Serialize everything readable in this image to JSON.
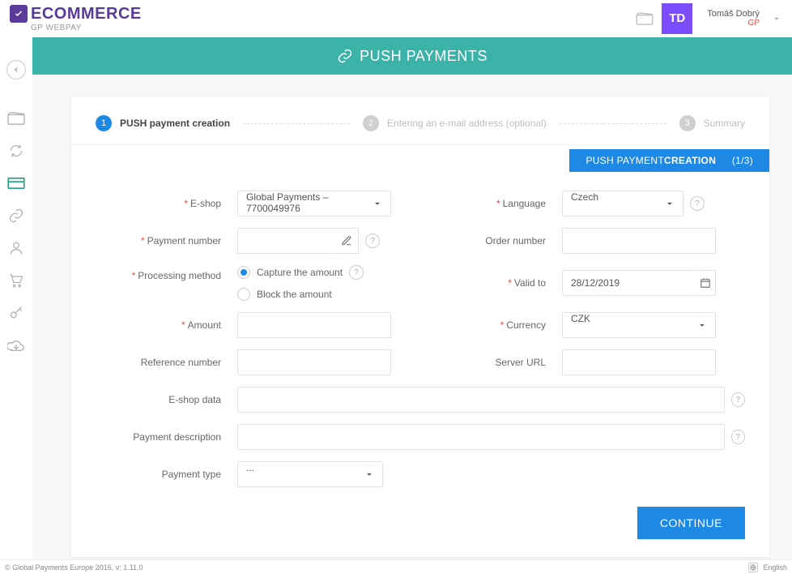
{
  "header": {
    "brand": "ECOMMERCE",
    "brand_sub": "GP WEBPAY",
    "avatar": "TD",
    "user_name": "Tomáš Dobrý",
    "user_co": "GP"
  },
  "banner": {
    "title": "PUSH PAYMENTS"
  },
  "stepper": {
    "s1": {
      "num": "1",
      "label": "PUSH payment creation"
    },
    "s2": {
      "num": "2",
      "label": "Entering an e-mail address (optional)"
    },
    "s3": {
      "num": "3",
      "label": "Summary"
    }
  },
  "progress": {
    "pre": "PUSH PAYMENT",
    "bold": "CREATION",
    "frac": "(1/3)"
  },
  "labels": {
    "eshop": "E-shop",
    "language": "Language",
    "payment_number": "Payment number",
    "order_number": "Order number",
    "processing_method": "Processing method",
    "valid_to": "Valid to",
    "amount": "Amount",
    "currency": "Currency",
    "reference_number": "Reference number",
    "server_url": "Server URL",
    "eshop_data": "E-shop data",
    "payment_description": "Payment description",
    "payment_type": "Payment type"
  },
  "values": {
    "eshop": "Global Payments – 7700049976",
    "language": "Czech",
    "payment_number": "",
    "order_number": "",
    "valid_to": "28/12/2019",
    "amount": "",
    "currency": "CZK",
    "reference_number": "",
    "server_url": "",
    "eshop_data": "",
    "payment_description": "",
    "payment_type": "..."
  },
  "radio": {
    "capture": "Capture the amount",
    "block": "Block the amount"
  },
  "buttons": {
    "continue": "CONTINUE"
  },
  "footer": {
    "copyright": "© Global Payments Europe 2016, v: 1.11.0",
    "lang": "English"
  }
}
